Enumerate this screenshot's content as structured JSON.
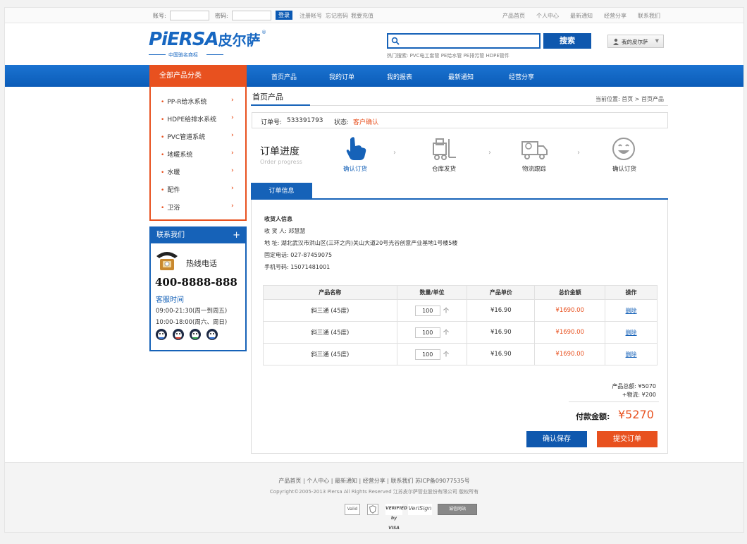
{
  "topbar": {
    "account_label": "账号:",
    "password_label": "密码:",
    "login_button": "登录",
    "links_left": [
      "注册帐号",
      "忘记密码",
      "我要充值"
    ],
    "links_right": [
      "产品首页",
      "个人中心",
      "最新通知",
      "经营分享",
      "联系我们"
    ]
  },
  "header": {
    "logo_text": "PiERSA",
    "logo_cn": "皮尔萨",
    "logo_reg": "®",
    "logo_sub": "中国驰名商标",
    "search_placeholder": "",
    "search_button": "搜索",
    "hot_search": "热门搜索: PVC电工套管  PE给水管  PE排污管  HDPE管件",
    "my_account": "我的皮尔萨"
  },
  "nav": {
    "category_title": "全部产品分类",
    "items": [
      "首页产品",
      "我的订单",
      "我的报表",
      "最新通知",
      "经营分享"
    ]
  },
  "categories": [
    "PP-R给水系统",
    "HDPE给排水系统",
    "PVC管道系统",
    "地暖系统",
    "水暖",
    "配件",
    "卫浴"
  ],
  "contact": {
    "title": "联系我们",
    "plus": "+",
    "hotline_label": "热线电话",
    "phone": "400-8888-888",
    "service_title": "客服时间",
    "hours": [
      "09:00-21:30(周一到周五)",
      "10:00-18:00(周六、周日)"
    ]
  },
  "main": {
    "title": "首页产品",
    "breadcrumb": "当前位置: 首页 > 首页产品",
    "order_label": "订单号:",
    "order_no": "533391793",
    "status_label": "状态:",
    "status_value": "客户确认",
    "progress_title": "订单进度",
    "progress_sub": "Order progress",
    "steps": [
      "确认订货",
      "仓库发货",
      "物流跟踪",
      "确认订货"
    ],
    "tab": "订单信息",
    "receiver": {
      "heading": "收货人信息",
      "name": "收 货 人: 邓慧慧",
      "address": "地     址: 湖北武汉市洪山区(三环之内)关山大道20号光谷创意产业基地1号楼5楼",
      "tel": "固定电话: 027-87459075",
      "mobile": "手机号码: 15071481001"
    },
    "table": {
      "headers": [
        "产品名称",
        "数量/单位",
        "产品单价",
        "总价金额",
        "操作"
      ],
      "rows": [
        {
          "name": "斜三通 (45度)",
          "qty": "100",
          "unit": "个",
          "price": "¥16.90",
          "total": "¥1690.00",
          "op": "删除"
        },
        {
          "name": "斜三通 (45度)",
          "qty": "100",
          "unit": "个",
          "price": "¥16.90",
          "total": "¥1690.00",
          "op": "删除"
        },
        {
          "name": "斜三通 (45度)",
          "qty": "100",
          "unit": "个",
          "price": "¥16.90",
          "total": "¥1690.00",
          "op": "删除"
        }
      ]
    },
    "product_total": "产品总额: ¥5070",
    "shipping": "+物流: ¥200",
    "pay_label": "付款金额:",
    "pay_value": "¥5270",
    "save_button": "确认保存",
    "submit_button": "提交订单"
  },
  "footer": {
    "links": "产品首页  |  个人中心  |  最新通知  |  经营分享  |  联系我们        苏ICP备09077535号",
    "copyright": "Copyright©2005-2013 Piersa All Rights Reserved   江苏皮尔萨管业股份有限公司 版权所有",
    "badges": [
      "Valid",
      "",
      "VERIFIED by VISA",
      "VeriSign",
      "诚信网站"
    ]
  },
  "colors": {
    "brand_blue": "#1662b8",
    "accent_orange": "#e8511f"
  }
}
